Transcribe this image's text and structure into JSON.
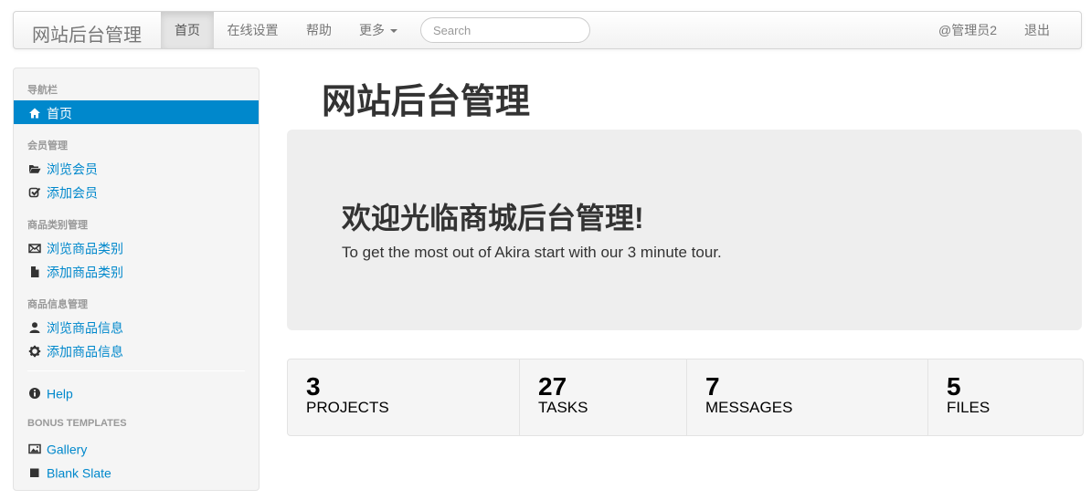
{
  "navbar": {
    "brand": "网站后台管理",
    "items": [
      {
        "label": "首页"
      },
      {
        "label": "在线设置"
      },
      {
        "label": "帮助"
      },
      {
        "label": "更多"
      }
    ],
    "search_placeholder": "Search",
    "user": "@管理员2",
    "logout": "退出"
  },
  "sidebar": {
    "headers": [
      "导航栏",
      "会员管理",
      "商品类别管理",
      "商品信息管理",
      "BONUS TEMPLATES"
    ],
    "items": [
      {
        "label": "首页",
        "icon": "home-icon"
      },
      {
        "label": "浏览会员",
        "icon": "folder-open-icon"
      },
      {
        "label": "添加会员",
        "icon": "check-icon"
      },
      {
        "label": "浏览商品类别",
        "icon": "envelope-icon"
      },
      {
        "label": "添加商品类别",
        "icon": "file-icon"
      },
      {
        "label": "浏览商品信息",
        "icon": "user-icon"
      },
      {
        "label": "添加商品信息",
        "icon": "gear-icon"
      },
      {
        "label": "Help",
        "icon": "info-icon"
      },
      {
        "label": "Gallery",
        "icon": "picture-icon"
      },
      {
        "label": "Blank Slate",
        "icon": "stop-icon"
      }
    ]
  },
  "main": {
    "title": "网站后台管理",
    "hero": {
      "title": "欢迎光临商城后台管理!",
      "text": "To get the most out of Akira start with our 3 minute tour."
    },
    "stats": [
      {
        "value": "3",
        "label": "Projects"
      },
      {
        "value": "27",
        "label": "Tasks"
      },
      {
        "value": "7",
        "label": "Messages"
      },
      {
        "value": "5",
        "label": "Files"
      }
    ]
  },
  "colors": {
    "accent": "#0088cc",
    "link": "#0088cc",
    "hero_bg": "#eeeeee"
  }
}
